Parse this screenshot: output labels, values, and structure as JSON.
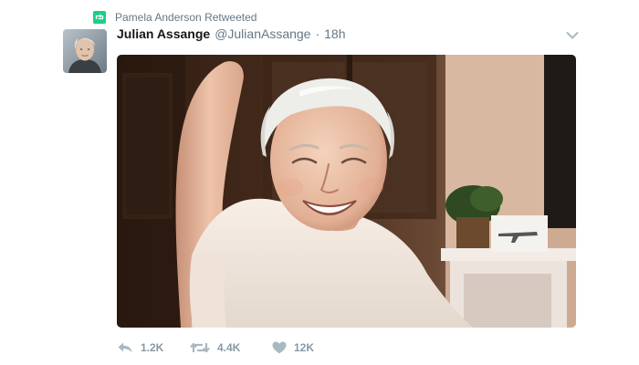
{
  "retweet_context": {
    "icon": "retweet-badge-icon",
    "text": "Pamela Anderson Retweeted",
    "accent": "#19cf86"
  },
  "author": {
    "name": "Julian Assange",
    "handle": "@JulianAssange",
    "separator": "·",
    "time": "18h",
    "avatar": "avatar-photo"
  },
  "media": {
    "type": "photo",
    "subject": "smiling man with white hair, arm raised behind head"
  },
  "actions": {
    "reply": {
      "icon": "reply-icon",
      "count": "1.2K"
    },
    "retweet": {
      "icon": "retweet-icon",
      "count": "4.4K"
    },
    "like": {
      "icon": "heart-icon",
      "count": "12K"
    }
  },
  "colors": {
    "name": "#14171a",
    "secondary": "#657786",
    "action": "#8899a6"
  }
}
